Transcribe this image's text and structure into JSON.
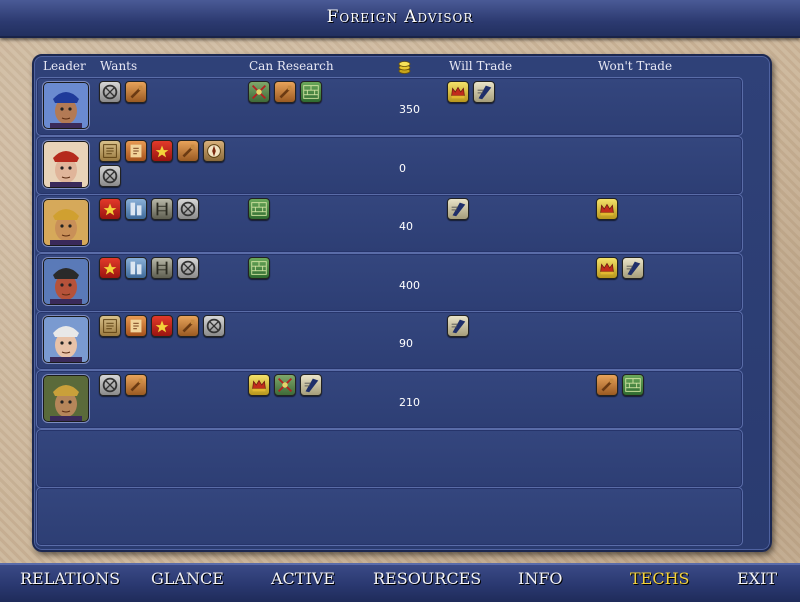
{
  "screen_title": "Foreign Advisor",
  "columns": {
    "leader": "Leader",
    "wants": "Wants",
    "can_research": "Can Research",
    "gold_icon": "gold-coin-icon",
    "will_trade": "Will Trade",
    "wont_trade": "Won't Trade"
  },
  "rows": [
    {
      "leader_icon": "leader-portrait-blue-crown",
      "gold": "350",
      "wants": [
        "wheel-tech-icon",
        "bronze-tech-icon"
      ],
      "can_research": [
        "warrior-code-tech-icon",
        "bronze-tech-icon",
        "masonry-tech-icon"
      ],
      "will_trade": [
        "monarchy-tech-icon",
        "writing-tech-icon"
      ],
      "wont_trade": []
    },
    {
      "leader_icon": "leader-portrait-red-queen",
      "gold": "0",
      "wants": [
        "philosophy-tech-icon",
        "mathematics-tech-icon",
        "code-of-laws-tech-icon",
        "bronze-tech-icon",
        "compass-tech-icon",
        "wheel-tech-icon"
      ],
      "can_research": [],
      "will_trade": [],
      "wont_trade": []
    },
    {
      "leader_icon": "leader-portrait-gold-headdress",
      "gold": "40",
      "wants": [
        "code-of-laws-tech-icon",
        "iron-working-tech-icon",
        "construction-tech-icon",
        "wheel-tech-icon"
      ],
      "can_research": [
        "masonry-tech-icon"
      ],
      "will_trade": [
        "writing-tech-icon"
      ],
      "wont_trade": [
        "monarchy-tech-icon"
      ]
    },
    {
      "leader_icon": "leader-portrait-warpaint",
      "gold": "400",
      "wants": [
        "code-of-laws-tech-icon",
        "iron-working-tech-icon",
        "construction-tech-icon",
        "wheel-tech-icon"
      ],
      "can_research": [
        "masonry-tech-icon"
      ],
      "will_trade": [],
      "wont_trade": [
        "monarchy-tech-icon",
        "writing-tech-icon"
      ]
    },
    {
      "leader_icon": "leader-portrait-white-hair",
      "gold": "90",
      "wants": [
        "philosophy-tech-icon",
        "mathematics-tech-icon",
        "code-of-laws-tech-icon",
        "bronze-tech-icon",
        "wheel-tech-icon"
      ],
      "can_research": [],
      "will_trade": [
        "writing-tech-icon"
      ],
      "wont_trade": []
    },
    {
      "leader_icon": "leader-portrait-bearded-king",
      "gold": "210",
      "wants": [
        "wheel-tech-icon",
        "bronze-tech-icon"
      ],
      "can_research": [
        "monarchy-tech-icon",
        "warrior-code-tech-icon",
        "writing-tech-icon"
      ],
      "will_trade": [],
      "wont_trade": [
        "bronze-tech-icon",
        "masonry-tech-icon"
      ]
    }
  ],
  "tabs": [
    {
      "label": "RELATIONS"
    },
    {
      "label": "GLANCE"
    },
    {
      "label": "ACTIVE"
    },
    {
      "label": "RESOURCES"
    },
    {
      "label": "INFO"
    },
    {
      "label": "TECHS",
      "active": true
    },
    {
      "label": "EXIT"
    }
  ],
  "colors": {
    "active_tab": "#f4d23c",
    "panel": "#2f4178",
    "parchment": "#ccb69a"
  }
}
